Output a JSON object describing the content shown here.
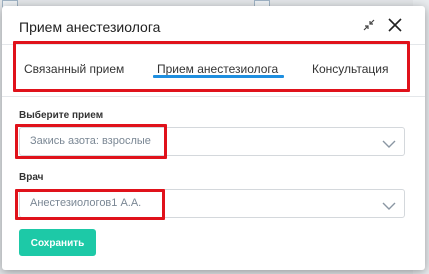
{
  "dialog": {
    "title": "Прием анестезиолога"
  },
  "tabs": [
    {
      "label": "Связанный прием",
      "active": false
    },
    {
      "label": "Прием анестезиолога",
      "active": true
    },
    {
      "label": "Консультация",
      "active": false
    }
  ],
  "form": {
    "appointment": {
      "label": "Выберите прием",
      "value": "Закись азота: взрослые"
    },
    "doctor": {
      "label": "Врач",
      "value": "Анестезиологов1 А.А."
    },
    "save_label": "Сохранить"
  },
  "background": {
    "fragment_1": "20",
    "fragment_2": "0"
  },
  "colors": {
    "accent": "#1e8fe0",
    "save_button": "#1dc9a7",
    "highlight": "#e0121b"
  },
  "icons": {
    "collapse": "collapse-arrows-icon",
    "close": "close-icon",
    "dropdown": "chevron-down-icon"
  }
}
